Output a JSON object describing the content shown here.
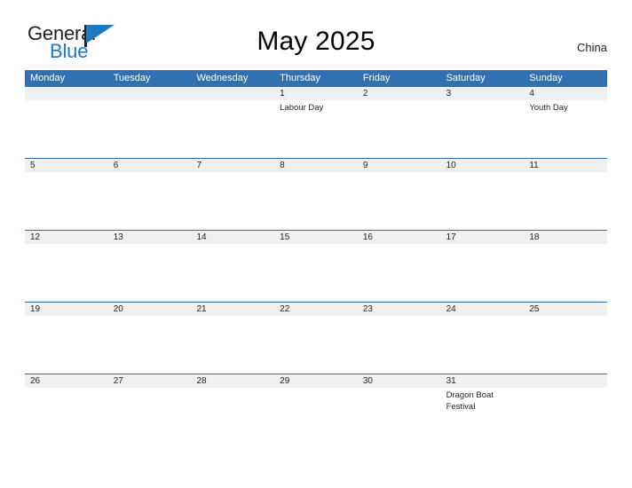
{
  "logo": {
    "word_top": "General",
    "word_bottom": "Blue",
    "flag_icon": "blue-triangle-flag-icon",
    "color_dark": "#231f20",
    "color_blue": "#1f7bc1"
  },
  "header": {
    "title": "May 2025",
    "region": "China"
  },
  "theme": {
    "header_blue": "#3171b2",
    "date_band_gray": "#f0f0f0",
    "text_dark": "#231f20",
    "background": "#ffffff"
  },
  "calendar": {
    "month": "May",
    "year": "2025",
    "weekdays": [
      "Monday",
      "Tuesday",
      "Wednesday",
      "Thursday",
      "Friday",
      "Saturday",
      "Sunday"
    ],
    "weeks": [
      [
        {
          "date": "",
          "event": ""
        },
        {
          "date": "",
          "event": ""
        },
        {
          "date": "",
          "event": ""
        },
        {
          "date": "1",
          "event": "Labour Day"
        },
        {
          "date": "2",
          "event": ""
        },
        {
          "date": "3",
          "event": ""
        },
        {
          "date": "4",
          "event": "Youth Day"
        }
      ],
      [
        {
          "date": "5",
          "event": ""
        },
        {
          "date": "6",
          "event": ""
        },
        {
          "date": "7",
          "event": ""
        },
        {
          "date": "8",
          "event": ""
        },
        {
          "date": "9",
          "event": ""
        },
        {
          "date": "10",
          "event": ""
        },
        {
          "date": "11",
          "event": ""
        }
      ],
      [
        {
          "date": "12",
          "event": ""
        },
        {
          "date": "13",
          "event": ""
        },
        {
          "date": "14",
          "event": ""
        },
        {
          "date": "15",
          "event": ""
        },
        {
          "date": "16",
          "event": ""
        },
        {
          "date": "17",
          "event": ""
        },
        {
          "date": "18",
          "event": ""
        }
      ],
      [
        {
          "date": "19",
          "event": ""
        },
        {
          "date": "20",
          "event": ""
        },
        {
          "date": "21",
          "event": ""
        },
        {
          "date": "22",
          "event": ""
        },
        {
          "date": "23",
          "event": ""
        },
        {
          "date": "24",
          "event": ""
        },
        {
          "date": "25",
          "event": ""
        }
      ],
      [
        {
          "date": "26",
          "event": ""
        },
        {
          "date": "27",
          "event": ""
        },
        {
          "date": "28",
          "event": ""
        },
        {
          "date": "29",
          "event": ""
        },
        {
          "date": "30",
          "event": ""
        },
        {
          "date": "31",
          "event": "Dragon Boat Festival"
        },
        {
          "date": "",
          "event": ""
        }
      ]
    ]
  }
}
